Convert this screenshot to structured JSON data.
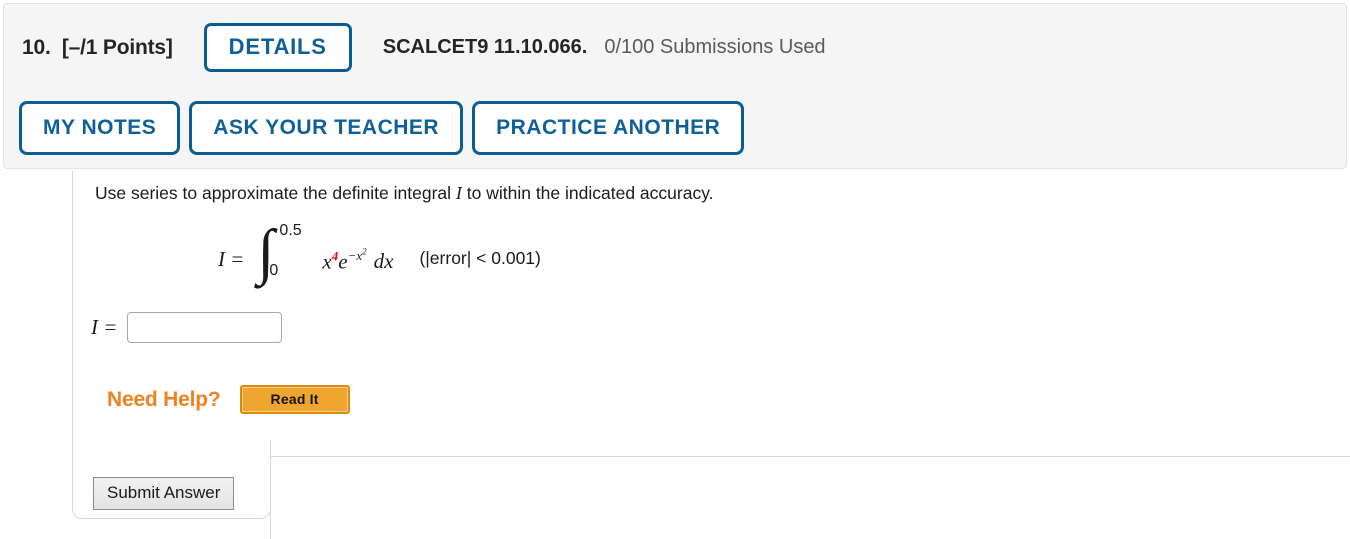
{
  "header": {
    "question_number": "10.",
    "points_label": "[–/1 Points]",
    "details_label": "DETAILS",
    "assignment_code": "SCALCET9 11.10.066.",
    "submissions_used": "0/100 Submissions Used",
    "accent_color": "#0b5c94",
    "background_color": "#f5f5f5",
    "action_buttons": [
      {
        "label": "MY NOTES"
      },
      {
        "label": "ASK YOUR TEACHER"
      },
      {
        "label": "PRACTICE ANOTHER"
      }
    ]
  },
  "question": {
    "prompt_before": "Use series to approximate the definite integral ",
    "prompt_variable": "I",
    "prompt_after": " to within the indicated accuracy.",
    "math": {
      "lhs": "I =",
      "integral_glyph": "∫",
      "limit_upper": "0.5",
      "limit_lower": "0",
      "integrand_base": "x",
      "integrand_exponent": "4",
      "integrand_exponent_color": "#e8000d",
      "integrand_e": "e",
      "integrand_e_exponent": "−x",
      "integrand_e_exponent_power": "2",
      "differential": "dx",
      "error_note": "(|error| < 0.001)"
    }
  },
  "answer": {
    "label": "I =",
    "value": "",
    "placeholder": ""
  },
  "help": {
    "label": "Need Help?",
    "label_color": "#f08020",
    "read_it_label": "Read It",
    "read_it_color": "#efa52f"
  },
  "footer": {
    "submit_label": "Submit Answer"
  }
}
